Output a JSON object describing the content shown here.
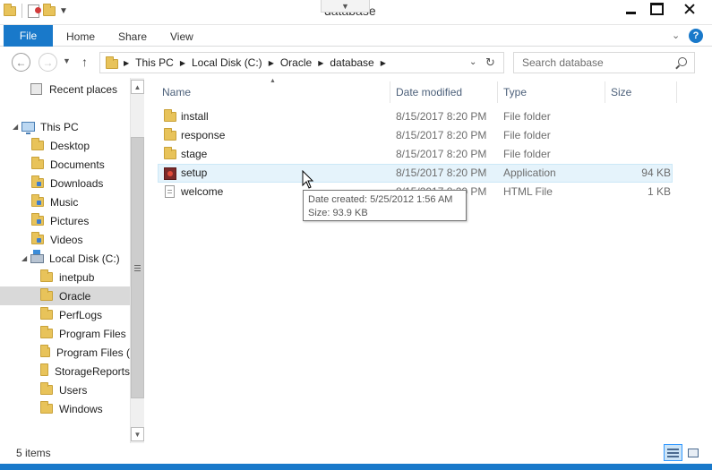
{
  "window": {
    "title": "database"
  },
  "ribbon": {
    "tabs": [
      "File",
      "Home",
      "Share",
      "View"
    ],
    "help": "?"
  },
  "address": {
    "crumbs": [
      "This PC",
      "Local Disk (C:)",
      "Oracle",
      "database"
    ]
  },
  "search": {
    "placeholder": "Search database"
  },
  "nav_pane": {
    "items": [
      {
        "label": "Recent places",
        "icon": "recent-places-icon"
      },
      {
        "label": "This PC",
        "icon": "computer-icon"
      },
      {
        "label": "Desktop",
        "icon": "folder-icon"
      },
      {
        "label": "Documents",
        "icon": "folder-icon"
      },
      {
        "label": "Downloads",
        "icon": "folder-icon"
      },
      {
        "label": "Music",
        "icon": "folder-icon"
      },
      {
        "label": "Pictures",
        "icon": "folder-icon"
      },
      {
        "label": "Videos",
        "icon": "folder-icon"
      },
      {
        "label": "Local Disk (C:)",
        "icon": "disk-icon"
      },
      {
        "label": "inetpub",
        "icon": "folder-icon"
      },
      {
        "label": "Oracle",
        "icon": "folder-icon",
        "selected": true
      },
      {
        "label": "PerfLogs",
        "icon": "folder-icon"
      },
      {
        "label": "Program Files",
        "icon": "folder-icon"
      },
      {
        "label": "Program Files (",
        "icon": "folder-icon"
      },
      {
        "label": "StorageReports",
        "icon": "folder-icon"
      },
      {
        "label": "Users",
        "icon": "folder-icon"
      },
      {
        "label": "Windows",
        "icon": "folder-icon"
      }
    ]
  },
  "columns": {
    "name": "Name",
    "date": "Date modified",
    "type": "Type",
    "size": "Size"
  },
  "files": [
    {
      "name": "install",
      "date": "8/15/2017 8:20 PM",
      "type": "File folder",
      "size": ""
    },
    {
      "name": "response",
      "date": "8/15/2017 8:20 PM",
      "type": "File folder",
      "size": ""
    },
    {
      "name": "stage",
      "date": "8/15/2017 8:20 PM",
      "type": "File folder",
      "size": ""
    },
    {
      "name": "setup",
      "date": "8/15/2017 8:20 PM",
      "type": "Application",
      "size": "94 KB"
    },
    {
      "name": "welcome",
      "date": "8/15/2017 8:20 PM",
      "type": "HTML File",
      "size": "1 KB"
    }
  ],
  "tooltip": {
    "line1": "Date created: 5/25/2012 1:56 AM",
    "line2": "Size: 93.9 KB"
  },
  "status": {
    "items_count": "5 items"
  },
  "colors": {
    "accent": "#1979ca",
    "selection": "#d9d9d9",
    "hover": "#e5f3fb"
  }
}
